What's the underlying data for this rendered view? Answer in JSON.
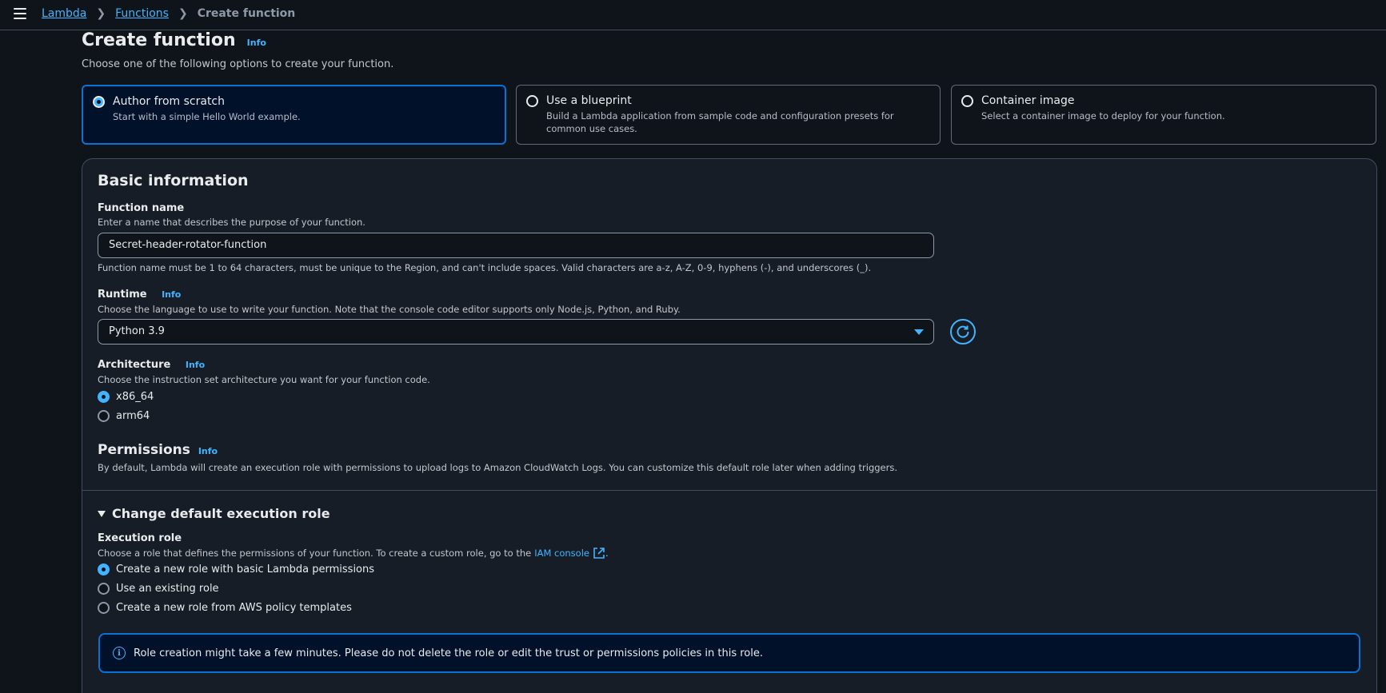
{
  "breadcrumb": {
    "items": [
      "Lambda",
      "Functions"
    ],
    "current": "Create function"
  },
  "page": {
    "title": "Create function",
    "info": "Info",
    "description": "Choose one of the following options to create your function."
  },
  "options": [
    {
      "title": "Author from scratch",
      "description": "Start with a simple Hello World example.",
      "selected": true
    },
    {
      "title": "Use a blueprint",
      "description": "Build a Lambda application from sample code and configuration presets for common use cases.",
      "selected": false
    },
    {
      "title": "Container image",
      "description": "Select a container image to deploy for your function.",
      "selected": false
    }
  ],
  "basic_info": {
    "heading": "Basic information",
    "function_name": {
      "label": "Function name",
      "description": "Enter a name that describes the purpose of your function.",
      "value": "Secret-header-rotator-function",
      "constraint": "Function name must be 1 to 64 characters, must be unique to the Region, and can't include spaces. Valid characters are a-z, A-Z, 0-9, hyphens (-), and underscores (_)."
    },
    "runtime": {
      "label": "Runtime",
      "info": "Info",
      "description": "Choose the language to use to write your function. Note that the console code editor supports only Node.js, Python, and Ruby.",
      "value": "Python 3.9"
    },
    "architecture": {
      "label": "Architecture",
      "info": "Info",
      "description": "Choose the instruction set architecture you want for your function code.",
      "options": [
        "x86_64",
        "arm64"
      ],
      "selected": "x86_64"
    }
  },
  "permissions": {
    "heading": "Permissions",
    "info": "Info",
    "description": "By default, Lambda will create an execution role with permissions to upload logs to Amazon CloudWatch Logs. You can customize this default role later when adding triggers."
  },
  "execution_role": {
    "expander": "Change default execution role",
    "label": "Execution role",
    "description_prefix": "Choose a role that defines the permissions of your function. To create a custom role, go to the",
    "iam_link": "IAM console",
    "description_suffix": ".",
    "options": [
      "Create a new role with basic Lambda permissions",
      "Use an existing role",
      "Create a new role from AWS policy templates"
    ],
    "selected": "Create a new role with basic Lambda permissions"
  },
  "alert": {
    "text": "Role creation might take a few minutes. Please do not delete the role or edit the trust or permissions policies in this role.",
    "icon": "info-icon"
  },
  "colors": {
    "accent": "#42b4ff",
    "selected_border": "#0972d3",
    "background": "#0f141a"
  }
}
